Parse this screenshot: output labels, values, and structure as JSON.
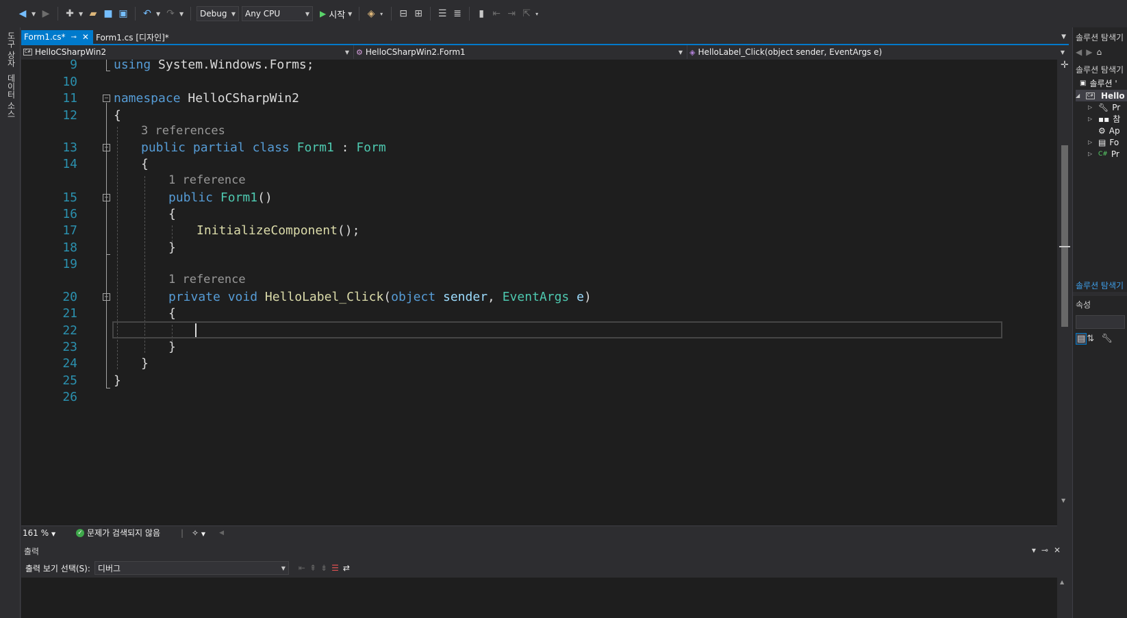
{
  "toolbar": {
    "configuration": "Debug",
    "platform": "Any CPU",
    "start_label": "시작"
  },
  "left_strip": {
    "tab1": "도구 상자",
    "tab2": "데이터 소스"
  },
  "tabs": {
    "active": "Form1.cs*",
    "designer": "Form1.cs [디자인]*"
  },
  "navbar": {
    "project": "HelloCSharpWin2",
    "class": "HelloCSharpWin2.Form1",
    "member": "HelloLabel_Click(object sender, EventArgs e)"
  },
  "code": {
    "l9": "9",
    "l10": "10",
    "l11": "11",
    "l12": "12",
    "l13": "13",
    "l14": "14",
    "l15": "15",
    "l16": "16",
    "l17": "17",
    "l18": "18",
    "l19": "19",
    "l20": "20",
    "l21": "21",
    "l22": "22",
    "l23": "23",
    "l24": "24",
    "l25": "25",
    "l26": "26",
    "kw_using": "using",
    "t_using": " System.Windows.Forms;",
    "kw_namespace": "namespace",
    "t_namespace": " HelloCSharpWin2",
    "open_brace": "{",
    "close_brace": "}",
    "lens_class": "3 references",
    "kw_public": "public",
    "kw_partial": "partial",
    "kw_class": "class",
    "ty_form1": "Form1",
    "colon": " : ",
    "ty_form": "Form",
    "lens_ctor": "1 reference",
    "fn_ctor": "Form1",
    "parens": "()",
    "fn_init": "InitializeComponent",
    "init_tail": "();",
    "lens_method": "1 reference",
    "kw_private": "private",
    "kw_void": "void",
    "fn_click": "HelloLabel_Click",
    "paren_open": "(",
    "kw_object": "object",
    "pm_sender": " sender",
    "comma": ", ",
    "ty_eventargs": "EventArgs",
    "pm_e": " e",
    "paren_close": ")"
  },
  "editor_status": {
    "zoom": "161 %",
    "issues": "문제가 검색되지 않음"
  },
  "output": {
    "title": "출력",
    "source_label": "출력 보기 선택(S):",
    "source_value": "디버그"
  },
  "solution_explorer": {
    "title": "솔루션 탐색기",
    "search_label": "솔루션 탐색기",
    "solution_row": "솔루션 '",
    "project_row": "Hello",
    "item1": "Pr",
    "item2": "참",
    "item3": "Ap",
    "item4": "Fo",
    "item5": "Pr",
    "bottom_tab": "솔루션 탐색기"
  },
  "properties": {
    "title": "속성"
  }
}
